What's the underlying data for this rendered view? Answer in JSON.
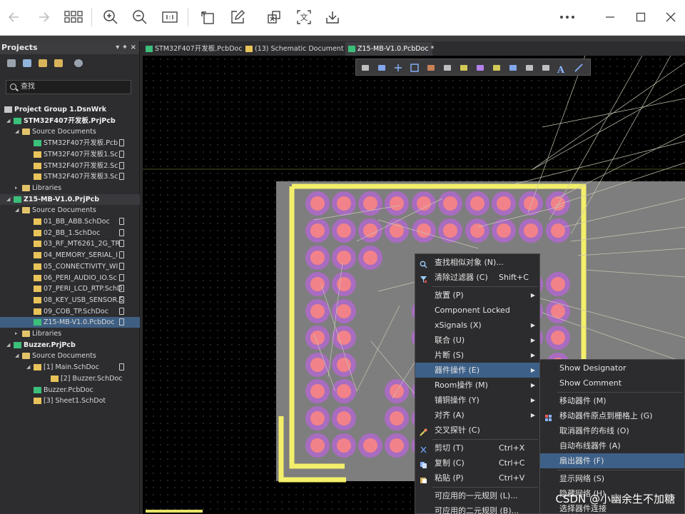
{
  "toolbar": {
    "icons": [
      "back-arrow-icon",
      "forward-arrow-icon",
      "grid-view-icon",
      "zoom-in-icon",
      "zoom-out-icon",
      "actual-size-icon",
      "rotate-icon",
      "edit-icon",
      "crop-icon",
      "translate-icon",
      "save-icon",
      "more-icon",
      "minimize-icon",
      "maximize-icon",
      "close-icon"
    ],
    "translate_glyph": "文"
  },
  "projects_panel": {
    "title": "Projects",
    "controls": "▾ ✦ ×",
    "search_placeholder": "查找",
    "tree": [
      {
        "label": "Project Group 1.DsnWrk",
        "level": 0,
        "bold": true,
        "arrow": "",
        "icon": "workspace"
      },
      {
        "label": "STM32F407开发板.PrjPcb",
        "level": 1,
        "bold": true,
        "arrow": "◢",
        "icon": "pcbproj"
      },
      {
        "label": "Source Documents",
        "level": 2,
        "bold": false,
        "arrow": "◢",
        "icon": "folder"
      },
      {
        "label": "STM32F407开发板.Pcb",
        "level": 3,
        "bold": false,
        "arrow": "",
        "icon": "pcb",
        "doc": true
      },
      {
        "label": "STM32F407开发板1.Sc",
        "level": 3,
        "bold": false,
        "arrow": "",
        "icon": "sch",
        "doc": true
      },
      {
        "label": "STM32F407开发板2.Sc",
        "level": 3,
        "bold": false,
        "arrow": "",
        "icon": "sch",
        "doc": true
      },
      {
        "label": "STM32F407开发板3.Sc",
        "level": 3,
        "bold": false,
        "arrow": "",
        "icon": "sch",
        "doc": true
      },
      {
        "label": "Libraries",
        "level": 2,
        "bold": false,
        "arrow": "▸",
        "icon": "folder"
      },
      {
        "label": "Z15-MB-V1.0.PrjPcb",
        "level": 1,
        "bold": true,
        "arrow": "◢",
        "icon": "pcbproj",
        "active": true
      },
      {
        "label": "Source Documents",
        "level": 2,
        "bold": false,
        "arrow": "◢",
        "icon": "folder"
      },
      {
        "label": "01_BB_ABB.SchDoc",
        "level": 3,
        "bold": false,
        "arrow": "",
        "icon": "sch",
        "doc": true
      },
      {
        "label": "02_BB_1.SchDoc",
        "level": 3,
        "bold": false,
        "arrow": "",
        "icon": "sch",
        "doc": true
      },
      {
        "label": "03_RF_MT6261_2G_TR",
        "level": 3,
        "bold": false,
        "arrow": "",
        "icon": "sch",
        "doc": true
      },
      {
        "label": "04_MEMORY_SERIAL_I",
        "level": 3,
        "bold": false,
        "arrow": "",
        "icon": "sch",
        "doc": true
      },
      {
        "label": "05_CONNECTIVITY_WI",
        "level": 3,
        "bold": false,
        "arrow": "",
        "icon": "sch",
        "doc": true
      },
      {
        "label": "06_PERI_AUDIO_IO.Sc",
        "level": 3,
        "bold": false,
        "arrow": "",
        "icon": "sch",
        "doc": true
      },
      {
        "label": "07_PERI_LCD_RTP.SchD",
        "level": 3,
        "bold": false,
        "arrow": "",
        "icon": "sch",
        "doc": true
      },
      {
        "label": "08_KEY_USB_SENSOR.S",
        "level": 3,
        "bold": false,
        "arrow": "",
        "icon": "sch",
        "doc": true
      },
      {
        "label": "09_COB_TP.SchDoc",
        "level": 3,
        "bold": false,
        "arrow": "",
        "icon": "sch",
        "doc": true
      },
      {
        "label": "Z15-MB-V1.0.PcbDoc",
        "level": 3,
        "bold": false,
        "arrow": "",
        "icon": "pcb",
        "doc": true,
        "selected": true
      },
      {
        "label": "Libraries",
        "level": 2,
        "bold": false,
        "arrow": "▸",
        "icon": "folder"
      },
      {
        "label": "Buzzer.PrjPcb",
        "level": 1,
        "bold": true,
        "arrow": "◢",
        "icon": "pcbproj"
      },
      {
        "label": "Source Documents",
        "level": 2,
        "bold": false,
        "arrow": "◢",
        "icon": "folder"
      },
      {
        "label": "[1] Main.SchDoc",
        "level": 3,
        "bold": false,
        "arrow": "◢",
        "icon": "sch",
        "doc": true
      },
      {
        "label": "[2] Buzzer.SchDoc",
        "level": 4,
        "bold": false,
        "arrow": "",
        "icon": "sch"
      },
      {
        "label": "Buzzer.PcbDoc",
        "level": 3,
        "bold": false,
        "arrow": "",
        "icon": "pcb"
      },
      {
        "label": "[3] Sheet1.SchDot",
        "level": 3,
        "bold": false,
        "arrow": "",
        "icon": "sch"
      }
    ]
  },
  "tabs": [
    {
      "label": "STM32F407开发板.PcbDoc",
      "icon": "pcb",
      "active": false
    },
    {
      "label": "(13) Schematic Document ▾",
      "icon": "sch",
      "active": false
    },
    {
      "label": "Z15-MB-V1.0.PcbDoc *",
      "icon": "pcb",
      "active": true
    }
  ],
  "pcb_toolbar": {
    "icons": [
      "filter-icon",
      "route-icon",
      "plus-icon",
      "rect-select-icon",
      "bar-chart-icon",
      "component-icon",
      "interactive-route-icon",
      "length-tune-icon",
      "pad-icon",
      "region-icon",
      "rect-fill-icon",
      "graph-icon",
      "text-icon",
      "line-icon"
    ],
    "text_glyph": "A"
  },
  "context_menu": {
    "items": [
      {
        "label": "查找相似对象 (N)...",
        "shortcut": "",
        "submenu": false,
        "icon": "find-similar"
      },
      {
        "label": "清除过滤器 (C)",
        "shortcut": "Shift+C",
        "submenu": false,
        "icon": "clear-filter"
      },
      {
        "sep": true
      },
      {
        "label": "放置 (P)",
        "shortcut": "",
        "submenu": true
      },
      {
        "label": "Component Locked",
        "shortcut": "",
        "submenu": false
      },
      {
        "label": "xSignals (X)",
        "shortcut": "",
        "submenu": true
      },
      {
        "label": "联合 (U)",
        "shortcut": "",
        "submenu": true
      },
      {
        "label": "片断 (S)",
        "shortcut": "",
        "submenu": true
      },
      {
        "label": "器件操作 (E)",
        "shortcut": "",
        "submenu": true,
        "highlight": true
      },
      {
        "label": "Room操作 (M)",
        "shortcut": "",
        "submenu": true
      },
      {
        "label": "铺铜操作 (Y)",
        "shortcut": "",
        "submenu": true
      },
      {
        "label": "对齐 (A)",
        "shortcut": "",
        "submenu": true
      },
      {
        "label": "交叉探针 (C)",
        "shortcut": "",
        "submenu": false,
        "icon": "cross-probe"
      },
      {
        "sep": true
      },
      {
        "label": "剪切 (T)",
        "shortcut": "Ctrl+X",
        "submenu": false,
        "icon": "cut"
      },
      {
        "label": "复制 (C)",
        "shortcut": "Ctrl+C",
        "submenu": false,
        "icon": "copy"
      },
      {
        "label": "粘贴 (P)",
        "shortcut": "Ctrl+V",
        "submenu": false,
        "icon": "paste"
      },
      {
        "sep": true
      },
      {
        "label": "可应用的一元规则 (L)...",
        "shortcut": "",
        "submenu": false
      },
      {
        "label": "可应用的二元规则 (B)...",
        "shortcut": "",
        "submenu": false
      }
    ]
  },
  "submenu": {
    "items": [
      {
        "label": "Show Designator"
      },
      {
        "label": "Show Comment"
      },
      {
        "sep": true
      },
      {
        "label": "移动器件 (M)"
      },
      {
        "label": "移动器件原点到栅格上 (G)",
        "icon": "grid-snap"
      },
      {
        "label": "取消器件的布线 (O)"
      },
      {
        "label": "自动布线器件 (A)"
      },
      {
        "label": "扇出器件 (F)",
        "highlight": true
      },
      {
        "sep": true
      },
      {
        "label": "显示网络 (S)"
      },
      {
        "label": "隐藏网络 (H)"
      },
      {
        "label": "选择器件连接"
      }
    ]
  },
  "watermark": "CSDN @小幽余生不加糖",
  "colors": {
    "pad_outer": "#a86cc0",
    "pad_inner": "#f2828a",
    "board": "#7e7e7e",
    "silkscreen": "#f3ef6a",
    "ratsnest": "#c8c8b4",
    "menu_highlight": "#3d6088"
  }
}
